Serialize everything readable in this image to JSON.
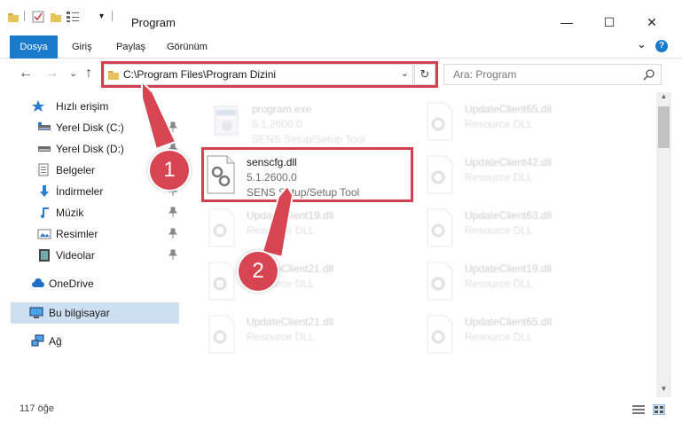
{
  "window": {
    "title": "Program",
    "minimize": "—",
    "maximize": "☐",
    "close": "✕"
  },
  "ribbon": {
    "tabs": [
      "Dosya",
      "Giriş",
      "Paylaş",
      "Görünüm"
    ],
    "expand": "⌄",
    "help": "?"
  },
  "nav": {
    "back": "←",
    "forward": "→",
    "recent": "⌄",
    "up": "↑",
    "address": "C:\\Program Files\\Program Dizini",
    "refresh": "↻",
    "search_placeholder": "Ara: Program"
  },
  "sidebar": {
    "items": [
      {
        "label": "Hızlı erişim",
        "icon": "star-icon"
      },
      {
        "label": "Yerel Disk (C:)",
        "icon": "drive-icon",
        "pinned": true
      },
      {
        "label": "Yerel Disk (D:)",
        "icon": "drive-icon",
        "pinned": true
      },
      {
        "label": "Belgeler",
        "icon": "documents-icon",
        "pinned": true
      },
      {
        "label": "İndirmeler",
        "icon": "download-icon",
        "pinned": true
      },
      {
        "label": "Müzik",
        "icon": "music-icon",
        "pinned": true
      },
      {
        "label": "Resimler",
        "icon": "pictures-icon",
        "pinned": true
      },
      {
        "label": "Videolar",
        "icon": "video-icon",
        "pinned": true
      },
      {
        "label": "OneDrive",
        "icon": "cloud-icon"
      },
      {
        "label": "Bu bilgisayar",
        "icon": "computer-icon",
        "selected": true
      },
      {
        "label": "Ağ",
        "icon": "network-icon"
      }
    ]
  },
  "files": [
    {
      "name": "program.exe",
      "version": "5.1.2600.0",
      "desc": "SENS Setup/Setup Tool",
      "faded": true
    },
    {
      "name": "UpdateClient65.dll",
      "version": "",
      "desc": "Resource DLL",
      "faded": true
    },
    {
      "name": "senscfg.dll",
      "version": "5.1.2600.0",
      "desc": "SENS Setup/Setup Tool",
      "faded": false
    },
    {
      "name": "UpdateClient42.dll",
      "version": "",
      "desc": "Resource DLL",
      "faded": true
    },
    {
      "name": "UpdateClient19.dll",
      "version": "",
      "desc": "Resource DLL",
      "faded": true
    },
    {
      "name": "UpdateClient63.dll",
      "version": "",
      "desc": "Resource DLL",
      "faded": true
    },
    {
      "name": "UpdateClient21.dll",
      "version": "",
      "desc": "Resource DLL",
      "faded": true
    },
    {
      "name": "UpdateClient19.dll",
      "version": "",
      "desc": "Resource DLL",
      "faded": true
    },
    {
      "name": "UpdateClient21.dll",
      "version": "",
      "desc": "Resource DLL",
      "faded": true
    },
    {
      "name": "UpdateClient65.dll",
      "version": "",
      "desc": "Resource DLL",
      "faded": true
    }
  ],
  "status": {
    "count": "117 öğe"
  },
  "callouts": [
    "1",
    "2"
  ],
  "colors": {
    "accent": "#1979ca",
    "highlight": "#d3404f",
    "callout": "#d74552",
    "selected": "#cce0f2"
  }
}
